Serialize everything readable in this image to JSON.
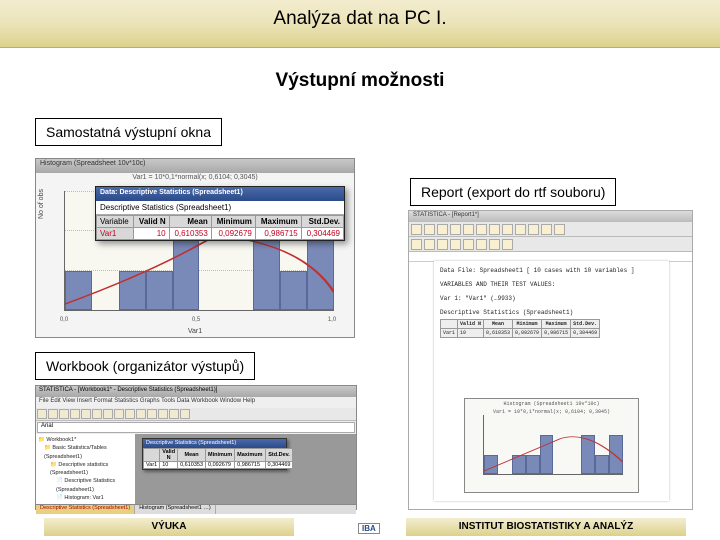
{
  "slide": {
    "title": "Analýza dat na PC I.",
    "subtitle": "Výstupní možnosti"
  },
  "labels": {
    "standalone": "Samostatná výstupní okna",
    "report": "Report (export do rtf souboru)",
    "workbook": "Workbook (organizátor výstupů)"
  },
  "fig1": {
    "window_title": "Histogram (Spreadsheet 10v*10c)",
    "caption": "Var1 = 10*0,1*normal(x; 0,6104; 0,3045)",
    "ylabel": "No of obs",
    "xlabel": "Var1",
    "popup_bar": "Data: Descriptive Statistics (Spreadsheet1)",
    "popup_sub": "Descriptive Statistics (Spreadsheet1)",
    "cols": [
      "Valid N",
      "Mean",
      "Minimum",
      "Maximum",
      "Std.Dev."
    ],
    "rowhdr_label": "Variable",
    "rowhdr": "Var1",
    "vals": [
      "10",
      "0,610353",
      "0,092679",
      "0,986715",
      "0,304469"
    ]
  },
  "fig2": {
    "window_title": "STATISTICA - [Report1*]",
    "header1": "Data File: Spreadsheet1 [ 10 cases with 10 variables ]",
    "header2": "VARIABLES AND THEIR TEST VALUES:",
    "header3": "Var 1: \"Var1\" (…9933)",
    "minicaption": "Descriptive Statistics (Spreadsheet1)",
    "cols": [
      "Valid N",
      "Mean",
      "Minimum",
      "Maximum",
      "Std.Dev."
    ],
    "chart_title1": "Histogram (Spreadsheet1 10v*10c)",
    "chart_title2": "Var1 = 10*0,1*normal(x; 0,6104; 0,3045)"
  },
  "fig3": {
    "window_title": "STATISTICA - [Workbook1* - Descriptive Statistics (Spreadsheet1)]",
    "menu": "File  Edit  View  Insert  Format  Statistics  Graphs  Tools  Data  Workbook  Window  Help",
    "formula_ref": "Arial",
    "tree": {
      "root": "Workbook1*",
      "n1": "Basic Statistics/Tables (Spreadsheet1)",
      "n2": "Descriptive statistics (Spreadsheet1)",
      "n3": "Descriptive Statistics (Spreadsheet1)",
      "n4": "Histogram: Var1"
    },
    "panel_title": "Descriptive Statistics (Spreadsheet1)",
    "tabs": {
      "t1": "Descriptive Statistics (Spreadsheet1)",
      "t2": "Histogram (Spreadsheet1 …)"
    }
  },
  "chart_data": [
    {
      "type": "bar_with_curve",
      "title": "Histogram (Spreadsheet 10v*10c)",
      "xlabel": "Var1",
      "ylabel": "No of obs",
      "categories": [
        0.0,
        0.1,
        0.2,
        0.3,
        0.4,
        0.5,
        0.6,
        0.7,
        0.8,
        0.9,
        1.0
      ],
      "values": [
        1,
        0,
        1,
        1,
        2,
        0,
        0,
        2,
        1,
        2
      ],
      "ylim": [
        0,
        3
      ],
      "fit": "normal(mean=0.6104, sd=0.3045)"
    },
    {
      "type": "bar_with_curve",
      "title": "Histogram (Spreadsheet1 10v*10c)",
      "categories": [
        0.0,
        0.1,
        0.2,
        0.3,
        0.4,
        0.5,
        0.6,
        0.7,
        0.8,
        0.9,
        1.0
      ],
      "values": [
        1,
        0,
        1,
        1,
        2,
        0,
        0,
        2,
        1,
        2
      ],
      "ylim": [
        0,
        3
      ]
    }
  ],
  "footer": {
    "left": "VÝUKA",
    "right": "INSTITUT BIOSTATISTIKY A ANALÝZ",
    "logo": "IBA"
  }
}
